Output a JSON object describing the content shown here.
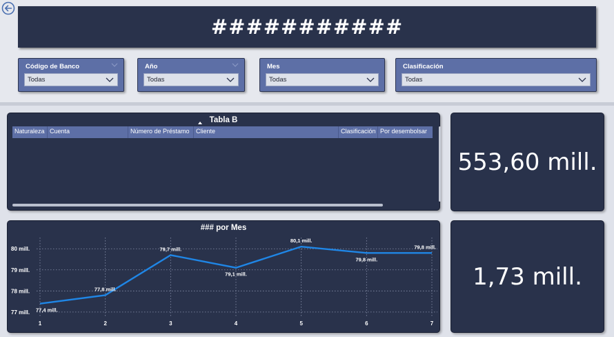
{
  "header": {
    "title": "###########"
  },
  "filters": [
    {
      "label": "Código de Banco",
      "value": "Todas"
    },
    {
      "label": "Año",
      "value": "Todas"
    },
    {
      "label": "Mes",
      "value": "Todas"
    },
    {
      "label": "Clasificación",
      "value": "Todas"
    }
  ],
  "table": {
    "title": "Tabla B",
    "columns": [
      "Naturaleza",
      "Cuenta",
      "Número de Préstamo",
      "Cliente",
      "Clasificación",
      "Por desembolsar"
    ],
    "sorted_column": "Cliente",
    "rows": []
  },
  "kpis": [
    {
      "value": "553,60 mill."
    },
    {
      "value": "1,73 mill."
    }
  ],
  "chart": {
    "title": "### por Mes"
  },
  "chart_data": {
    "type": "line",
    "title": "### por Mes",
    "x": [
      1,
      2,
      3,
      4,
      5,
      6,
      7
    ],
    "series": [
      {
        "values": [
          77.4,
          77.8,
          79.7,
          79.1,
          80.1,
          79.8,
          79.8
        ]
      }
    ],
    "data_labels": [
      "77,4 mill.",
      "77,8 mill.",
      "79,7 mill.",
      "79,1 mill.",
      "80,1 mill.",
      "79,8 mill.",
      "79,8 mill."
    ],
    "y_ticks": [
      77,
      78,
      79,
      80
    ],
    "y_tick_labels": [
      "77 mill.",
      "78 mill.",
      "79 mill.",
      "80 mill."
    ],
    "ylim": [
      76.8,
      80.4
    ],
    "grid": true,
    "line_color": "#1f86e6"
  },
  "colors": {
    "background": "#e6e8ee",
    "card": "#29324b",
    "slicer": "#5d6fa6",
    "text": "#ffffff"
  },
  "icons": {
    "back": "back-arrow-icon",
    "dropdown": "chevron-down-icon",
    "sort": "sort-ascending-icon"
  }
}
